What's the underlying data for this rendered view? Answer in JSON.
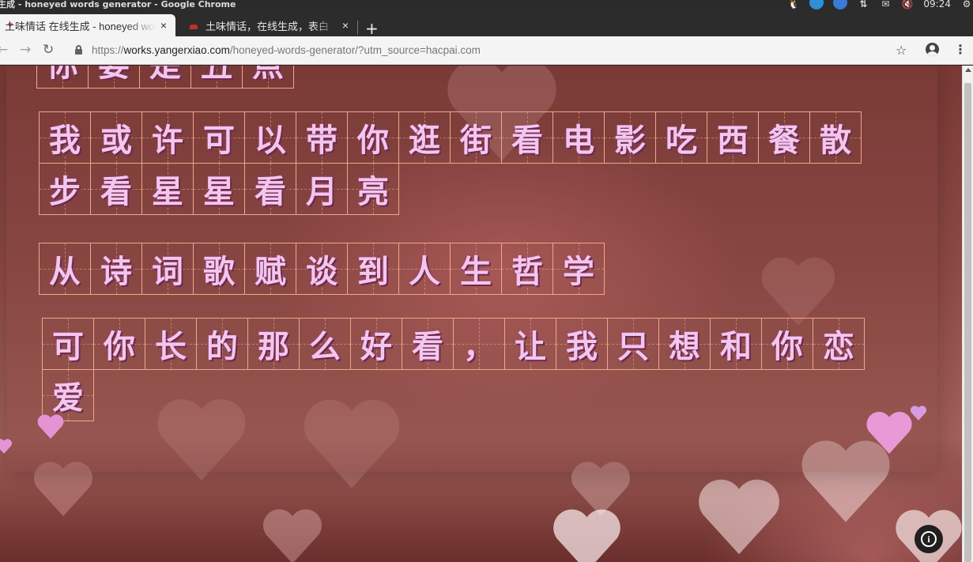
{
  "os_bar": {
    "window_title": "生成 - honeyed words generator - Google Chrome",
    "clock": "09:24"
  },
  "tabs": [
    {
      "label": "土味情话 在线生成 - honeyed words generator",
      "close": "×",
      "favicon": "heart-icon"
    },
    {
      "label": "土味情话，在线生成，表白",
      "close": "×",
      "favicon": "red-site-icon"
    }
  ],
  "new_tab": "+",
  "address_bar": {
    "scheme": "https://",
    "host": "works.yangerxiao.com",
    "path": "/honeyed-words-generator/?utm_source=hacpai.com"
  },
  "content": {
    "lines": [
      {
        "chars": [
          "你",
          "要",
          "是",
          "丑",
          "点"
        ]
      },
      {
        "chars": [
          "我",
          "或",
          "许",
          "可",
          "以",
          "带",
          "你",
          "逛",
          "街",
          "看",
          "电",
          "影",
          "吃",
          "西",
          "餐",
          "散",
          "步",
          "看",
          "星",
          "星",
          "看",
          "月",
          "亮"
        ]
      },
      {
        "chars": [
          "从",
          "诗",
          "词",
          "歌",
          "赋",
          "谈",
          "到",
          "人",
          "生",
          "哲",
          "学"
        ]
      },
      {
        "chars": [
          "可",
          "你",
          "长",
          "的",
          "那",
          "么",
          "好",
          "看",
          "，",
          "让",
          "我",
          "只",
          "想",
          "和",
          "你",
          "恋",
          "爱"
        ]
      }
    ],
    "info_button": "i"
  },
  "colors": {
    "grid_border": "#f2a58a",
    "char_fill": "#f3c6f0",
    "background": "#8f4a45"
  }
}
